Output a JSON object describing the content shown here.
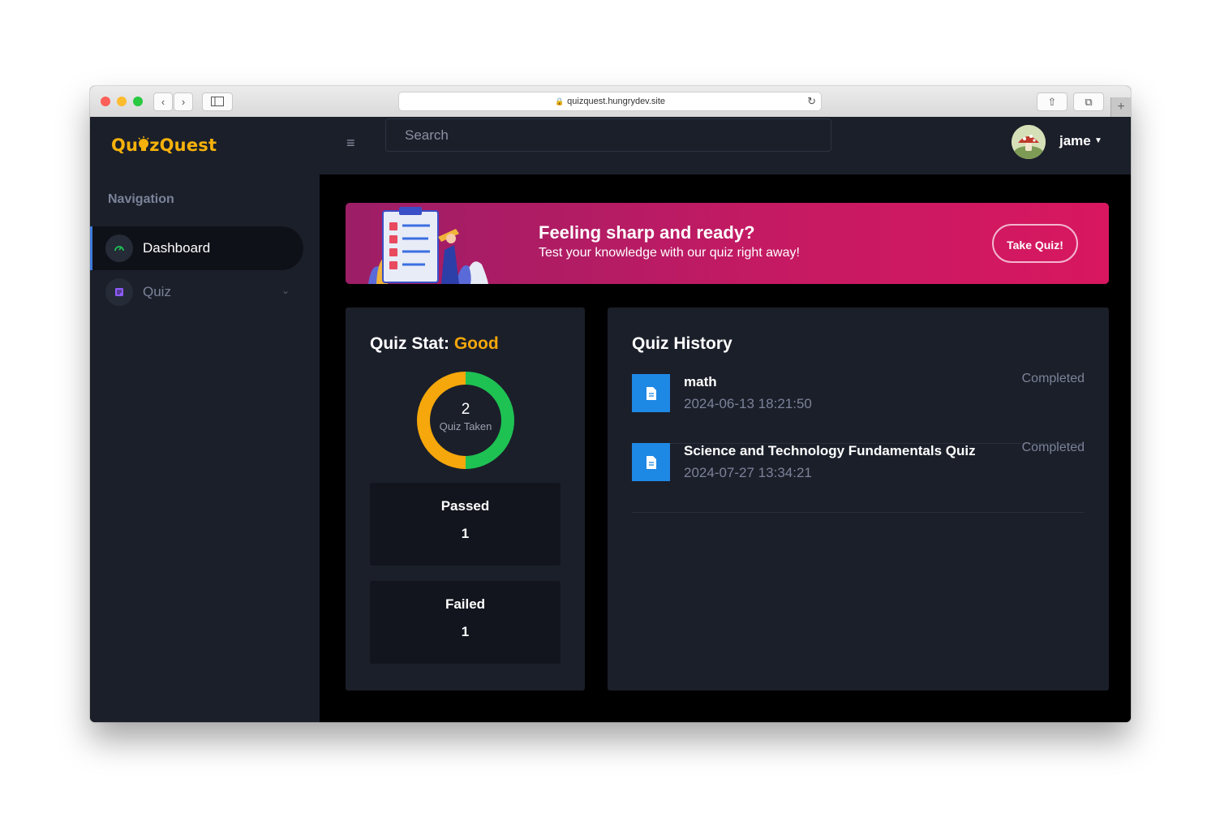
{
  "browser": {
    "url": "quizquest.hungrydev.site"
  },
  "app": {
    "logo_left": "Qu",
    "logo_right": "zQuest"
  },
  "sidebar": {
    "nav_title": "Navigation",
    "items": [
      {
        "label": "Dashboard",
        "icon": "gauge-icon",
        "active": true
      },
      {
        "label": "Quiz",
        "icon": "document-icon",
        "active": false
      }
    ]
  },
  "topbar": {
    "search_placeholder": "Search",
    "username": "jame"
  },
  "banner": {
    "title": "Feeling sharp and ready?",
    "subtitle": "Test your knowledge with our quiz right away!",
    "button_label": "Take Quiz!"
  },
  "stats": {
    "title_prefix": "Quiz Stat:",
    "rating": "Good",
    "total": "2",
    "total_label": "Quiz Taken",
    "passed_label": "Passed",
    "passed_value": "1",
    "failed_label": "Failed",
    "failed_value": "1",
    "colors": {
      "passed": "#1ec253",
      "failed": "#f5a70b"
    }
  },
  "history": {
    "title": "Quiz History",
    "rows": [
      {
        "name": "math",
        "date": "2024-06-13 18:21:50",
        "status": "Completed"
      },
      {
        "name": "Science and Technology Fundamentals Quiz",
        "date": "2024-07-27 13:34:21",
        "status": "Completed"
      }
    ]
  }
}
